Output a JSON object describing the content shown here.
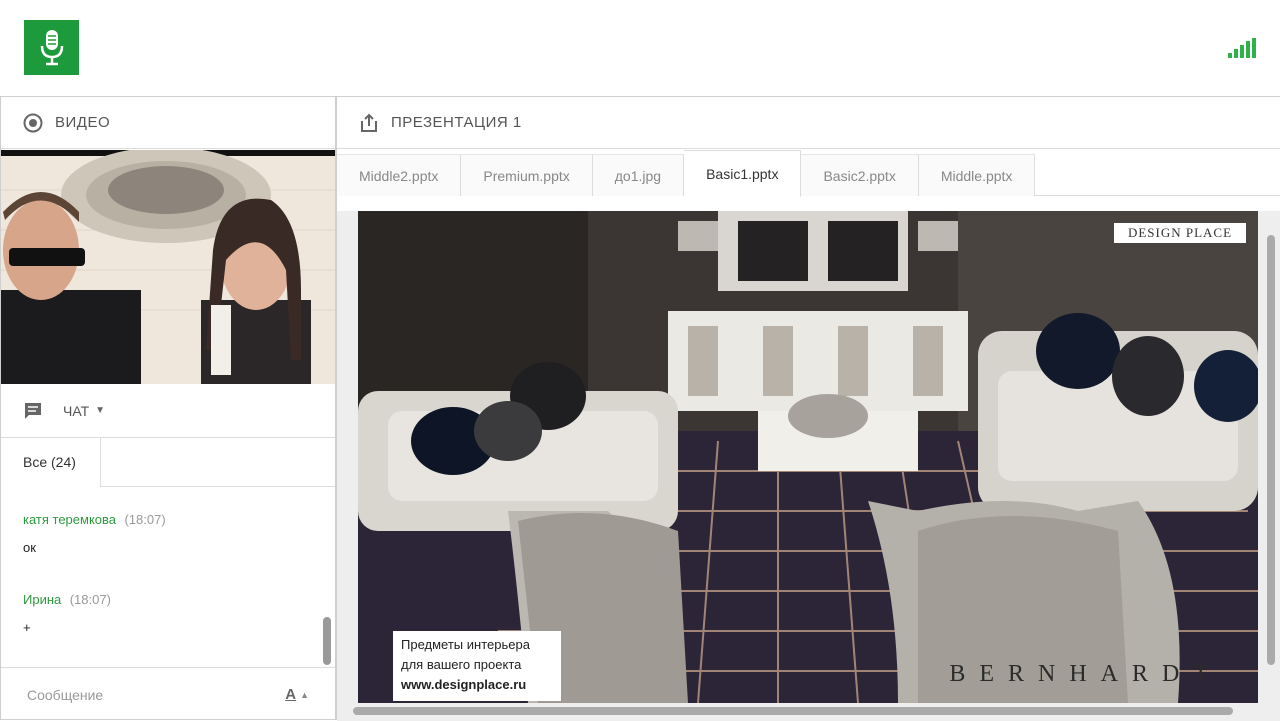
{
  "video_panel": {
    "title": "ВИДЕО"
  },
  "chat": {
    "title": "ЧАТ",
    "tab_label": "Все (24)",
    "messages": [
      {
        "author": "катя теремкова",
        "time": "(18:07)",
        "text": "ок"
      },
      {
        "author": "Ирина",
        "time": "(18:07)",
        "text": "+"
      }
    ],
    "composer_placeholder": "Сообщение",
    "format_label": "A"
  },
  "presentation": {
    "title": "ПРЕЗЕНТАЦИЯ 1",
    "tabs": [
      {
        "label": "Middle2.pptx"
      },
      {
        "label": "Premium.pptx"
      },
      {
        "label": "до1.jpg"
      },
      {
        "label": "Basic1.pptx"
      },
      {
        "label": "Basic2.pptx"
      },
      {
        "label": "Middle.pptx"
      }
    ],
    "active_tab": "Basic1.pptx",
    "slide": {
      "brand_box": "DESIGN PLACE",
      "caption_line1": "Предметы интерьера",
      "caption_line2": "для вашего проекта",
      "caption_url": "www.designplace.ru",
      "watermark": "BERNHARDT"
    }
  },
  "colors": {
    "accent_green": "#1d9b3c",
    "author_green": "#2e9a3e",
    "signal_green": "#2db34a"
  }
}
